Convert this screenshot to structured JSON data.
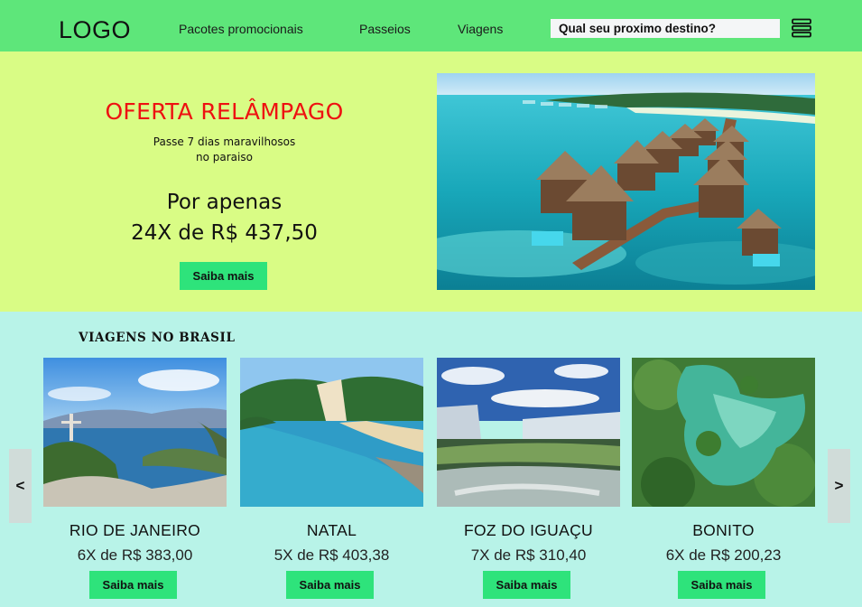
{
  "header": {
    "logo": "LOGO",
    "nav": [
      "Pacotes promocionais",
      "Passeios",
      "Viagens"
    ],
    "search_placeholder": "Qual seu proximo destino?"
  },
  "hero": {
    "title": "OFERTA RELÂMPAGO",
    "subtitle_line1": "Passe 7 dias maravilhosos",
    "subtitle_line2": "no paraiso",
    "price_line1": "Por apenas",
    "price_line2": "24X de R$ 437,50",
    "button": "Saiba mais",
    "image": "maldives-overwater-bungalows"
  },
  "section": {
    "title": "VIAGENS NO BRASIL",
    "prev": "<",
    "next": ">"
  },
  "cards": [
    {
      "name": "RIO DE JANEIRO",
      "price": "6X de R$ 383,00",
      "button": "Saiba mais",
      "image": "rio-de-janeiro-christ-redeemer"
    },
    {
      "name": "NATAL",
      "price": "5X de R$ 403,38",
      "button": "Saiba mais",
      "image": "natal-beach-dunes"
    },
    {
      "name": "FOZ DO IGUAÇU",
      "price": "7X de R$ 310,40",
      "button": "Saiba mais",
      "image": "iguacu-falls"
    },
    {
      "name": "BONITO",
      "price": "6X de R$ 200,23",
      "button": "Saiba mais",
      "image": "bonito-turquoise-river"
    }
  ],
  "colors": {
    "header_bg": "#5ee67a",
    "hero_bg": "#d9fc85",
    "section_bg": "#b8f3e8",
    "button_bg": "#2ee37b",
    "hero_title": "#ee1111"
  }
}
